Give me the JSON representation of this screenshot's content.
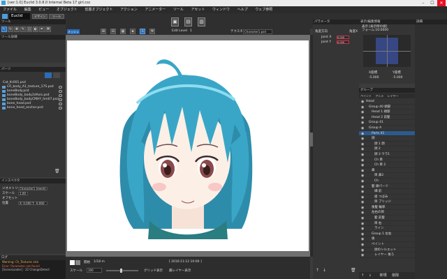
{
  "window": {
    "title": "[ver:1.0] Euclid 3.0.8.0 Internal Beta 17  girl.csc",
    "minimize": "–",
    "maximize": "☐",
    "close": "✕"
  },
  "menu": [
    "ファイル",
    "編集",
    "ビュー",
    "オブジェクト",
    "低層オブジェクト",
    "アクション",
    "アニメーター",
    "ツール",
    "アセット",
    "ウィンドウ",
    "ヘルプ",
    "ウェブ参照"
  ],
  "appbar": {
    "logo": "Euclid",
    "modes": [
      "デザイン",
      "ツール"
    ],
    "command_icons": [
      "open-icon",
      "save-icon",
      "export-icon"
    ]
  },
  "toolbar2": {
    "model_btn": "メッシュ",
    "edit_level_label": "Edit Level",
    "edit_level_value": "1",
    "texture_label": "テクスチャ",
    "texture_value": "Character1.psd"
  },
  "tools_panel": {
    "header": "ツール",
    "tools": [
      "select",
      "rotate",
      "pan",
      "brush",
      "eraser",
      "mask",
      "pen",
      "warp"
    ],
    "detail_header": "ツール詳細"
  },
  "files_panel": {
    "header": "パーツ",
    "root": "Cat_Kr001.psd",
    "items": [
      "CR_body_A1_texture_17S.psd",
      "boneBody.psd",
      "boneBody_body2dAxis.psd",
      "boneBody_bodyCMHY_hm07.psd",
      "bone_head.psd",
      "bone_head_anchor.psd"
    ]
  },
  "inspector": {
    "header": "インスペクタ",
    "rows": [
      {
        "label": "ジオメトリ",
        "value": "Character1 (mesh)"
      },
      {
        "label": "スケール",
        "value": "1.00"
      },
      {
        "label": "オフセット",
        "value": ""
      },
      {
        "label": "位置",
        "value": "X: 0.000    Y: -0.000"
      }
    ]
  },
  "log": {
    "header": "ログ",
    "lines": [
      "Warning: Ch_Textures skin",
      "Error: Parameter not found",
      "[SceneLoader] : 32 ChangeDetect"
    ]
  },
  "parameters": {
    "header": "パラメータ",
    "tab_label": "角度方向",
    "subtab": "角度X",
    "rows": [
      {
        "name": "Joint X",
        "value": "0.000"
      },
      {
        "name": "Joint Y",
        "value": "0.000"
      }
    ],
    "button_add": "作成"
  },
  "param_chart": {
    "header": "表示"
  },
  "deformer": {
    "header": "表示/編集情報",
    "items": [
      "表示 [表示時の値]",
      "フォーム:10:0000"
    ],
    "value_headers": [
      "X座標",
      "Y座標"
    ],
    "values": [
      "-5.000",
      "-5.000"
    ]
  },
  "layers": {
    "header": "グループ",
    "tabs": [
      "ペイント",
      "アニメ",
      "レイヤー"
    ],
    "rows": [
      "Head",
      "Group 40 頭部",
      "Head 1 頭部",
      "Head 2 前髪",
      "Group 41",
      "Group A",
      "Parts 41",
      "顔",
      "顔 1 顔",
      "顔 2",
      "顔 3 ウラ1",
      "Ch 目",
      "Ch 目 2",
      "鼻",
      "目 鼻2",
      "Ch",
      "髪 頭パーツ",
      "細 前",
      "眉 つばみ",
      "目 ブリッジ",
      "後髪 輪郭",
      "左右の目",
      "髪 前髪",
      "目 右",
      "ライン",
      "Group 1 左右",
      "後",
      "ペイント",
      "顔のシルエット",
      "レイヤー 後ろ"
    ],
    "selected_index": 6,
    "footer": [
      "↑",
      "↓",
      "新規",
      "削除"
    ]
  },
  "statusbar": {
    "scale_label": "スケール",
    "scale_value": "100",
    "coords": "[ 2016:11:12 10:00 ]",
    "viewopt1": "グリッド表示",
    "viewopt2": "最レイヤー表示",
    "text1": "開始",
    "text2": "1/18 m"
  },
  "right_panel_header": "詳細"
}
